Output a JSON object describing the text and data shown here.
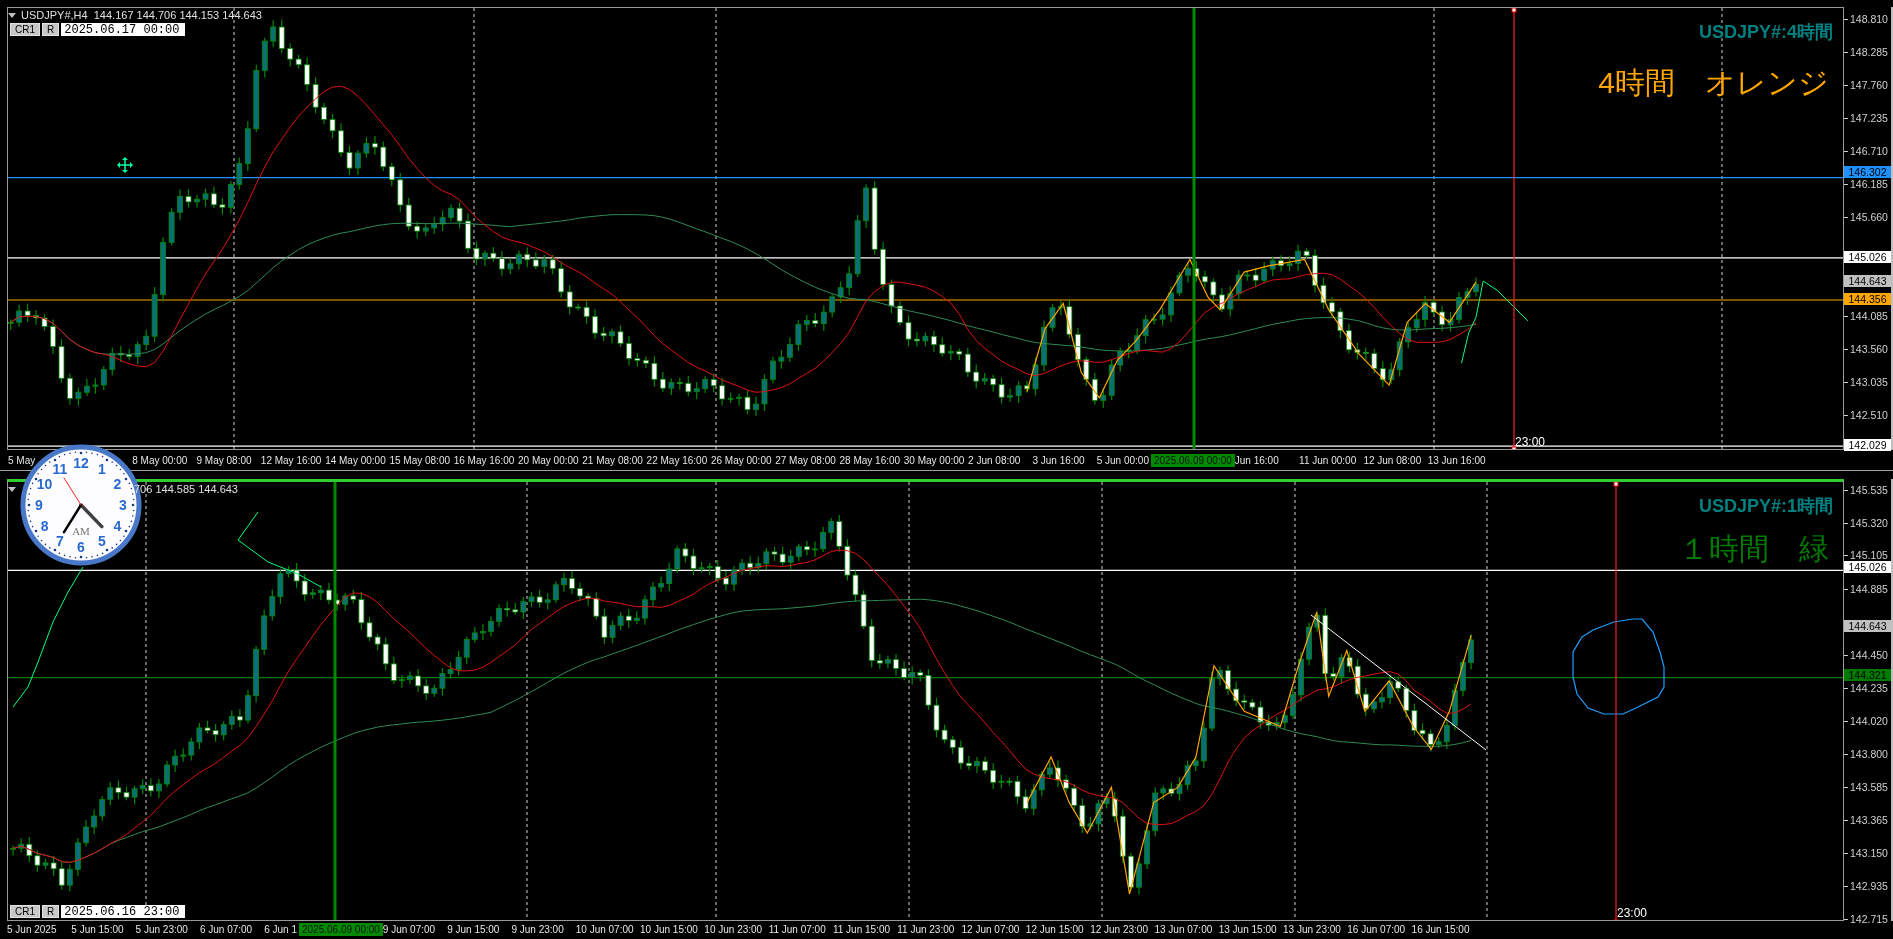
{
  "panes": [
    {
      "active": false,
      "header": "USDJPY#,H4  144.167 144.706 144.153 144.643",
      "buttons": [
        "CR1",
        "R"
      ],
      "datetime": "2025.06.17 00:00",
      "symbol_label": "USDJPY#:4時間",
      "note": {
        "text": "4時間　オレンジ",
        "color": "#ffa500"
      },
      "price_ticks": [
        "148.810",
        "148.285",
        "147.760",
        "147.235",
        "146.710",
        "146.185",
        "145.660",
        "144.085",
        "143.560",
        "143.035",
        "142.510"
      ],
      "price_tags": [
        {
          "text": "146.302",
          "color": "#1e90ff",
          "kind": "level"
        },
        {
          "text": "145.026",
          "color": "#ffffff",
          "kind": "level"
        },
        {
          "text": "144.643",
          "color": "#c0c0c0",
          "kind": "bid"
        },
        {
          "text": "144.356",
          "color": "#ffa500",
          "kind": "level"
        },
        {
          "text": "142.029",
          "color": "#ffffff",
          "kind": "level"
        }
      ],
      "time_labels": [
        {
          "text": "5 May",
          "kind": "plain"
        },
        {
          "text": "8 May 00:00",
          "kind": "plain"
        },
        {
          "text": "9 May 08:00",
          "kind": "plain"
        },
        {
          "text": "12 May 16:00",
          "kind": "plain"
        },
        {
          "text": "14 May 00:00",
          "kind": "plain"
        },
        {
          "text": "15 May 08:00",
          "kind": "plain"
        },
        {
          "text": "16 May 16:00",
          "kind": "plain"
        },
        {
          "text": "20 May 00:00",
          "kind": "plain"
        },
        {
          "text": "21 May 08:00",
          "kind": "plain"
        },
        {
          "text": "22 May 16:00",
          "kind": "plain"
        },
        {
          "text": "26 May 00:00",
          "kind": "plain"
        },
        {
          "text": "27 May 08:00",
          "kind": "plain"
        },
        {
          "text": "28 May 16:00",
          "kind": "plain"
        },
        {
          "text": "30 May 00:00",
          "kind": "plain"
        },
        {
          "text": "2 Jun 08:00",
          "kind": "plain"
        },
        {
          "text": "3 Jun 16:00",
          "kind": "plain"
        },
        {
          "text": "5 Jun 00:00",
          "kind": "plain"
        },
        {
          "text": "2025.06.09 00:00",
          "kind": "marker"
        },
        {
          "text": "Jun 16:00",
          "kind": "plain"
        },
        {
          "text": "11 Jun 00:00",
          "kind": "plain"
        },
        {
          "text": "12 Jun 08:00",
          "kind": "plain"
        },
        {
          "text": "13 Jun 16:00",
          "kind": "plain"
        }
      ],
      "cursor_label": "23:00"
    },
    {
      "active": true,
      "header": "706 144.585 144.643",
      "buttons": [
        "CR1",
        "R"
      ],
      "datetime": "2025.06.16 23:00",
      "symbol_label": "USDJPY#:1時間",
      "note": {
        "text": "１時間　緑",
        "color": "#007a00"
      },
      "price_ticks": [
        "145.535",
        "145.320",
        "145.105",
        "144.885",
        "144.450",
        "144.235",
        "144.020",
        "143.800",
        "143.585",
        "143.365",
        "143.150",
        "142.935",
        "142.715"
      ],
      "price_tags": [
        {
          "text": "145.026",
          "color": "#ffffff",
          "kind": "level"
        },
        {
          "text": "144.643",
          "color": "#c0c0c0",
          "kind": "bid"
        },
        {
          "text": "144.321",
          "color": "#007a00",
          "kind": "level"
        }
      ],
      "time_labels": [
        {
          "text": "5 Jun 2025",
          "kind": "plain"
        },
        {
          "text": "5 Jun 15:00",
          "kind": "plain"
        },
        {
          "text": "5 Jun 23:00",
          "kind": "plain"
        },
        {
          "text": "6 Jun 07:00",
          "kind": "plain"
        },
        {
          "text": "6 Jun 1",
          "kind": "plain"
        },
        {
          "text": "2025.06.09 00:00",
          "kind": "marker"
        },
        {
          "text": "9 Jun 07:00",
          "kind": "plain"
        },
        {
          "text": "9 Jun 15:00",
          "kind": "plain"
        },
        {
          "text": "9 Jun 23:00",
          "kind": "plain"
        },
        {
          "text": "10 Jun 07:00",
          "kind": "plain"
        },
        {
          "text": "10 Jun 15:00",
          "kind": "plain"
        },
        {
          "text": "10 Jun 23:00",
          "kind": "plain"
        },
        {
          "text": "11 Jun 07:00",
          "kind": "plain"
        },
        {
          "text": "11 Jun 15:00",
          "kind": "plain"
        },
        {
          "text": "11 Jun 23:00",
          "kind": "plain"
        },
        {
          "text": "12 Jun 07:00",
          "kind": "plain"
        },
        {
          "text": "12 Jun 15:00",
          "kind": "plain"
        },
        {
          "text": "12 Jun 23:00",
          "kind": "plain"
        },
        {
          "text": "13 Jun 07:00",
          "kind": "plain"
        },
        {
          "text": "13 Jun 15:00",
          "kind": "plain"
        },
        {
          "text": "13 Jun 23:00",
          "kind": "plain"
        },
        {
          "text": "16 Jun 07:00",
          "kind": "plain"
        },
        {
          "text": "16 Jun 15:00",
          "kind": "plain"
        }
      ],
      "cursor_label": "23:00"
    }
  ],
  "clock": {
    "numerals": [
      "11",
      "12",
      "1",
      "10",
      "2",
      "9",
      "3",
      "8",
      "4",
      "7",
      "5",
      "6"
    ],
    "meridiem": "AM"
  }
}
